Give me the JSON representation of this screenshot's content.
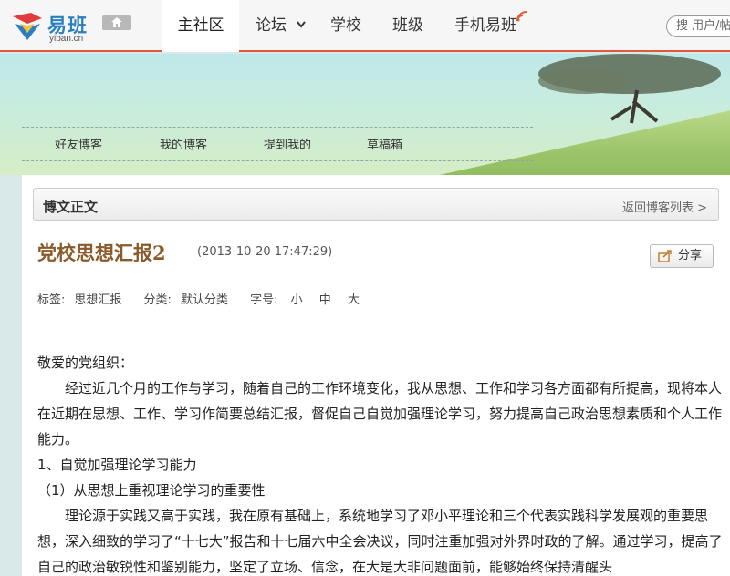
{
  "logo": {
    "name": "易班",
    "sub": "yiban.cn"
  },
  "nav": {
    "main": "主社区",
    "forum": "论坛",
    "school": "学校",
    "class": "班级",
    "mobile": "手机易班"
  },
  "search": {
    "placeholder": "搜 用户/帖"
  },
  "blog_tabs": [
    "好友博客",
    "我的博客",
    "提到我的",
    "草稿箱"
  ],
  "section": {
    "title": "博文正文",
    "back": "返回博客列表 >"
  },
  "post": {
    "title": "党校思想汇报2",
    "date": "(2013-10-20 17:47:29)",
    "share": "分享",
    "tags_label": "标签:",
    "tags_value": "思想汇报",
    "category_label": "分类:",
    "category_value": "默认分类",
    "font_label": "字号:",
    "font_sizes": [
      "小",
      "中",
      "大"
    ]
  },
  "body": [
    "敬爱的党组织：",
    "经过近几个月的工作与学习，随着自己的工作环境变化，我从思想、工作和学习各方面都有所提高，现将本人在近期在思想、工作、学习作简要总结汇报，督促自己自觉加强理论学习，努力提高自己政治思想素质和个人工作能力。",
    "1、自觉加强理论学习能力",
    "（1）从思想上重视理论学习的重要性",
    "理论源于实践又高于实践，我在原有基础上，系统地学习了邓小平理论和三个代表实践科学发展观的重要思想，深入细致的学习了“十七大”报告和十七届六中全会决议，同时注重加强对外界时政的了解。通过学习，提高了自己的政治敏锐性和鉴别能力，坚定了立场、信念，在大是大非问题面前，能够始终保持清醒头"
  ],
  "colors": {
    "accent": "#e05a3a",
    "title": "#8a5a2a",
    "brand": "#2a7fc0"
  }
}
